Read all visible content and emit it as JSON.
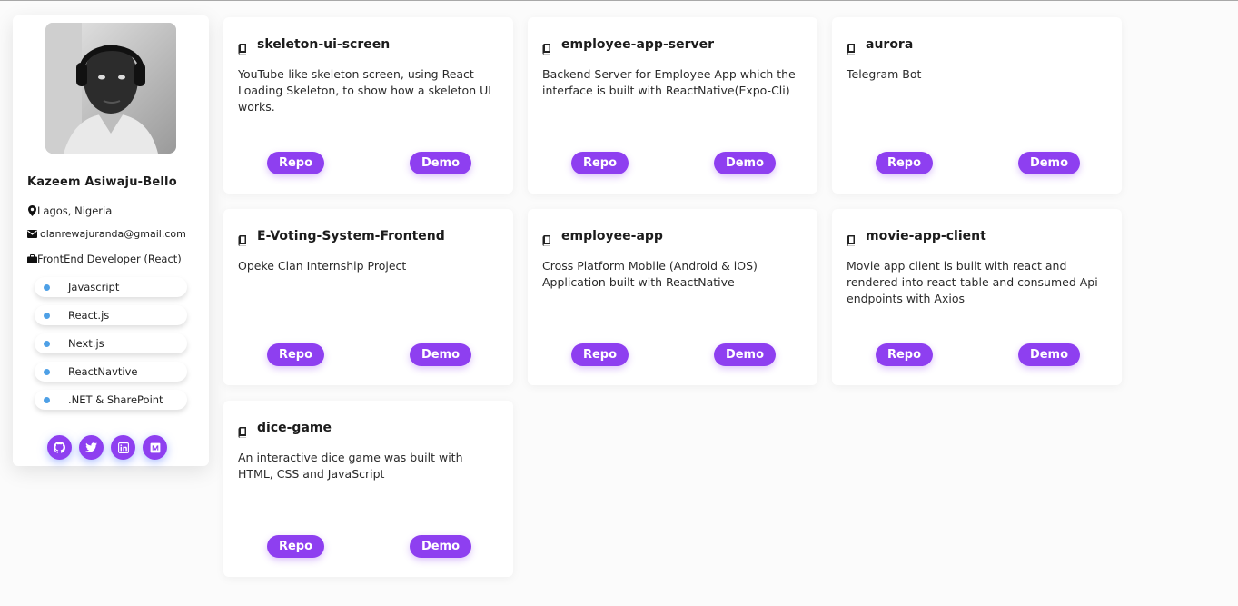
{
  "profile": {
    "name": "Kazeem Asiwaju-Bello",
    "location": "Lagos, Nigeria",
    "email": "olanrewajuranda@gmail.com",
    "role": "FrontEnd Developer (React)",
    "skills": [
      "Javascript",
      "React.js",
      "Next.js",
      "ReactNavtive",
      ".NET & SharePoint"
    ],
    "socials": [
      "github-icon",
      "twitter-icon",
      "linkedin-icon",
      "medium-icon"
    ]
  },
  "projects": [
    {
      "title": "skeleton-ui-screen",
      "description": "YouTube-like skeleton screen, using React Loading Skeleton, to show how a skeleton UI works.",
      "repo_label": "Repo",
      "demo_label": "Demo"
    },
    {
      "title": "employee-app-server",
      "description": "Backend Server for Employee App which the interface is built with ReactNative(Expo-Cli)",
      "repo_label": "Repo",
      "demo_label": "Demo"
    },
    {
      "title": "aurora",
      "description": "Telegram Bot",
      "repo_label": "Repo",
      "demo_label": "Demo"
    },
    {
      "title": "E-Voting-System-Frontend",
      "description": "Opeke Clan Internship Project",
      "repo_label": "Repo",
      "demo_label": "Demo"
    },
    {
      "title": "employee-app",
      "description": "Cross Platform Mobile (Android & iOS) Application built with ReactNative",
      "repo_label": "Repo",
      "demo_label": "Demo"
    },
    {
      "title": "movie-app-client",
      "description": "Movie app client is built with react and rendered into react-table and consumed Api endpoints with Axios",
      "repo_label": "Repo",
      "demo_label": "Demo"
    },
    {
      "title": "dice-game",
      "description": "An interactive dice game was built with HTML, CSS and JavaScript",
      "repo_label": "Repo",
      "demo_label": "Demo"
    }
  ],
  "colors": {
    "accent": "#8e3ff0",
    "skill_dot": "#4ea0e6",
    "background": "#fbfbfb"
  }
}
